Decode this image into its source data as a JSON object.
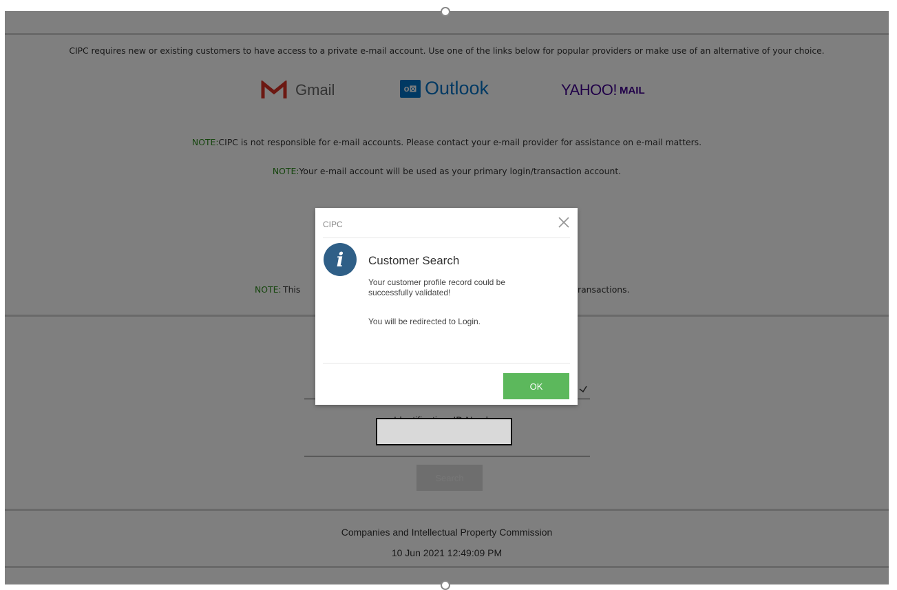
{
  "intro": {
    "text": "CIPC requires new or existing customers to have access to a private e-mail account. Use one of the links below for popular providers or make use of an alternative of your choice."
  },
  "providers": {
    "gmail_label": "Gmail",
    "outlook_label": "Outlook",
    "outlook_badge": "o⊠",
    "yahoo_label": "YAHOO!",
    "yahoo_mail_label": "MAIL"
  },
  "notes": {
    "label": "NOTE:",
    "note1": "CIPC is not responsible for e-mail accounts. Please contact your e-mail provider for assistance on e-mail matters.",
    "note2": "Your e-mail account will be used as your primary login/transaction account.",
    "note3_left": "This",
    "note3_right": "ransactions."
  },
  "form": {
    "id_label": "Identification: ID Number",
    "id_value": "",
    "search_label": "Search"
  },
  "footer": {
    "org": "Companies and Intellectual Property Commission",
    "datetime": "10 Jun 2021   12:49:09 PM"
  },
  "modal": {
    "title": "CIPC",
    "heading": "Customer Search",
    "icon_letter": "i",
    "message1": "Your customer profile record could be successfully validated!",
    "message2": "You will be redirected to Login.",
    "ok_label": "OK"
  },
  "colors": {
    "note_green": "#2a8a1a",
    "ok_green": "#5cb85c",
    "info_blue": "#2f5f87",
    "outlook_blue": "#0072c6",
    "yahoo_purple": "#400090",
    "gmail_red": "#d93025"
  }
}
